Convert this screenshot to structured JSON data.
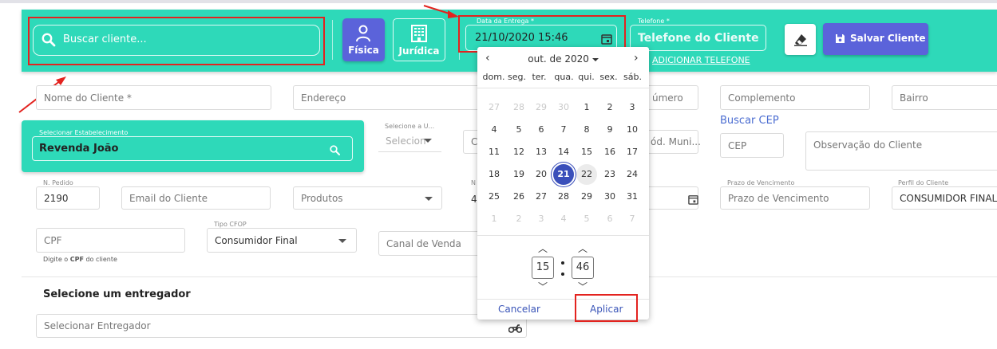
{
  "header": {
    "search_placeholder": "Buscar cliente...",
    "btn_fisica": "Física",
    "btn_juridica": "Jurídica",
    "data_entrega_label": "Data da Entrega *",
    "data_entrega_value": "21/10/2020 15:46",
    "telefone_label": "Telefone *",
    "telefone_placeholder": "Telefone do Cliente",
    "add_phone": "ADICIONAR TELEFONE",
    "save_label": "Salvar Cliente"
  },
  "form": {
    "nome_cliente": "Nome do Cliente *",
    "endereco": "Endereço",
    "numero": "úmero",
    "complemento": "Complemento",
    "bairro": "Bairro",
    "estab_label": "Selecionar Estabelecimento",
    "estab_value": "Revenda João",
    "select_u_label": "Selecione a U...",
    "select_u_ph": "Selecion",
    "c_partial": "C",
    "cod_muni": "ód. Muni...",
    "buscar_cep": "Buscar CEP",
    "cep": "CEP",
    "observacao": "Observação do Cliente",
    "n_pedido_label": "N. Pedido",
    "n_pedido_value": "2190",
    "email": "Email do Cliente",
    "produtos": "Produtos",
    "n_partial_label": "N",
    "four_partial": "4",
    "prazo_label": "Prazo de Vencimento",
    "prazo_ph": "Prazo de Vencimento",
    "perfil_label": "Perfil do Cliente",
    "perfil_value": "CONSUMIDOR FINAL",
    "cpf": "CPF",
    "cpf_helper_pre": "Digite o ",
    "cpf_helper_bold": "CPF",
    "cpf_helper_post": " do cliente",
    "cfop_label": "Tipo CFOP",
    "cfop_value": "Consumidor Final",
    "canal": "Canal de Venda",
    "entregador_title": "Selecione um entregador",
    "entregador_ph": "Selecionar Entregador"
  },
  "calendar": {
    "month": "out. de 2020",
    "prev": "‹",
    "next": "›",
    "weekdays": [
      "dom.",
      "seg.",
      "ter.",
      "qua.",
      "qui.",
      "sex.",
      "sáb."
    ],
    "weeks": [
      [
        "27",
        "28",
        "29",
        "30",
        "1",
        "2",
        "3"
      ],
      [
        "4",
        "5",
        "6",
        "7",
        "8",
        "9",
        "10"
      ],
      [
        "11",
        "12",
        "13",
        "14",
        "15",
        "16",
        "17"
      ],
      [
        "18",
        "19",
        "20",
        "21",
        "22",
        "23",
        "24"
      ],
      [
        "25",
        "26",
        "27",
        "28",
        "29",
        "30",
        "31"
      ],
      [
        "1",
        "2",
        "3",
        "4",
        "5",
        "6",
        "7"
      ]
    ],
    "selected_day": "21",
    "hour": "15",
    "minute": "46",
    "cancel": "Cancelar",
    "apply": "Aplicar"
  },
  "colors": {
    "teal": "#2ed9b9",
    "primary": "#5b63da",
    "selected_day": "#3a4fba",
    "highlight_red": "#e3231f",
    "link_blue": "#4a6cd1"
  }
}
